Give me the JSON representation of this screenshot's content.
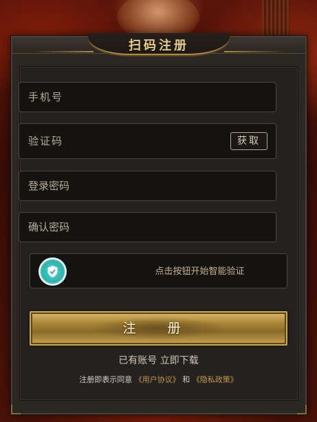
{
  "title": "扫码注册",
  "fields": {
    "phone_placeholder": "手机号",
    "code_placeholder": "验证码",
    "password_placeholder": "登录密码",
    "confirm_placeholder": "确认密码"
  },
  "get_code_label": "获取",
  "captcha": {
    "label": "点击按钮开始智能验证",
    "icon": "shield-check-icon"
  },
  "submit_label": "注 册",
  "login_row": {
    "prefix": "已有账号",
    "download": "立即下载"
  },
  "agreement": {
    "prefix": "注册即表示同意",
    "user_agreement": "《用户协议》",
    "conjunction": "和",
    "privacy_policy": "《隐私政策》"
  },
  "colors": {
    "gold": "#c9a65a",
    "title": "#e9cf8e",
    "link": "#c49a4e",
    "captcha_teal": "#2fb3ad"
  }
}
